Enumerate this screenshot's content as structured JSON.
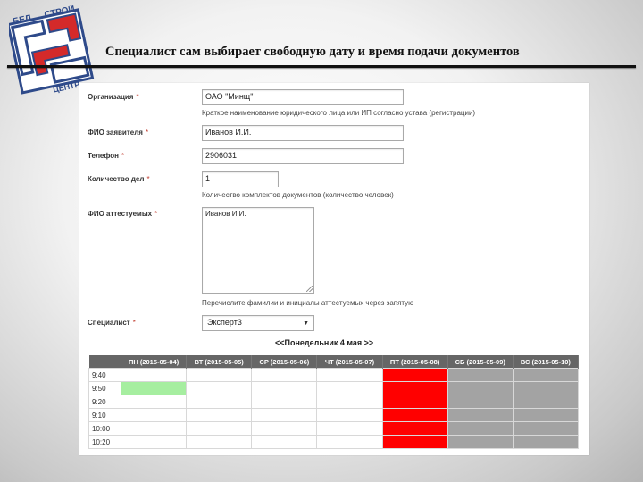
{
  "logo": {
    "top_word": "БЕЛ",
    "right_word": "СТРОЙ",
    "bottom_word": "ЦЕНТР"
  },
  "slide": {
    "title": "Специалист сам выбирает свободную дату и время подачи документов"
  },
  "form": {
    "required_mark": "*",
    "organization": {
      "label": "Организация",
      "value": "ОАО \"Минщ\"",
      "hint": "Краткое наименование юридического лица или ИП согласно устава (регистрации)"
    },
    "applicant": {
      "label": "ФИО заявителя",
      "value": "Иванов И.И."
    },
    "phone": {
      "label": "Телефон",
      "value": "2906031"
    },
    "cases": {
      "label": "Количество дел",
      "value": "1",
      "hint": "Количество комплектов документов (количество человек)"
    },
    "attested": {
      "label": "ФИО аттестуемых",
      "value": "Иванов И.И.",
      "hint": "Перечислите фамилии и инициалы аттестуемых через запятую"
    },
    "specialist": {
      "label": "Специалист",
      "value": "Эксперт3"
    }
  },
  "schedule": {
    "week_nav": "<<Понедельник 4 мая >>",
    "headers": [
      "",
      "ПН (2015-05-04)",
      "ВТ (2015-05-05)",
      "СР (2015-05-06)",
      "ЧТ (2015-05-07)",
      "ПТ (2015-05-08)",
      "СБ (2015-05-09)",
      "ВС (2015-05-10)"
    ],
    "times": [
      "9:40",
      "9:50",
      "9:20",
      "9:10",
      "10:00",
      "10:20"
    ],
    "colors": {
      "selected": "#a6eea0",
      "busy": "#ff0000",
      "weekend": "#a3a3a3",
      "header": "#666666"
    }
  }
}
